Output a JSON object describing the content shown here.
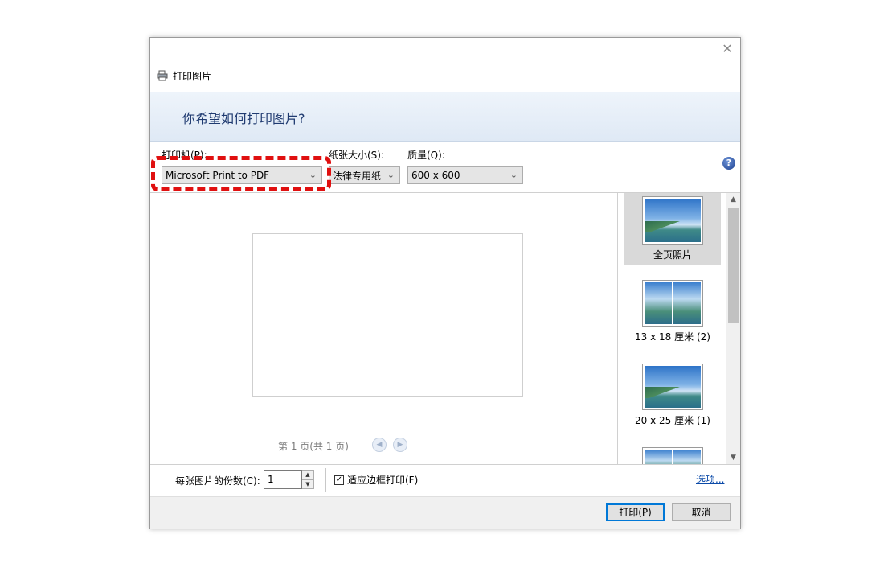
{
  "window": {
    "title": "打印图片",
    "close_glyph": "✕"
  },
  "banner": {
    "heading": "你希望如何打印图片?"
  },
  "settings": {
    "printer_label": "打印机(P):",
    "printer_value": "Microsoft Print to PDF",
    "paper_label": "纸张大小(S):",
    "paper_value": "法律专用纸",
    "quality_label": "质量(Q):",
    "quality_value": "600 x 600",
    "help_glyph": "?"
  },
  "preview": {
    "page_info": "第 1 页(共 1 页)"
  },
  "layouts": [
    {
      "label": "全页照片",
      "selected": true
    },
    {
      "label": "13 x 18 厘米 (2)",
      "selected": false
    },
    {
      "label": "20 x 25 厘米 (1)",
      "selected": false
    }
  ],
  "bottom": {
    "copies_label": "每张图片的份数(C):",
    "copies_value": "1",
    "fit_label": "适应边框打印(F)",
    "fit_checked": true,
    "options_link": "选项..."
  },
  "buttons": {
    "print": "打印(P)",
    "cancel": "取消"
  },
  "colors": {
    "highlight": "#e01010",
    "banner_text": "#1f3a70",
    "link": "#0b4aa8"
  }
}
